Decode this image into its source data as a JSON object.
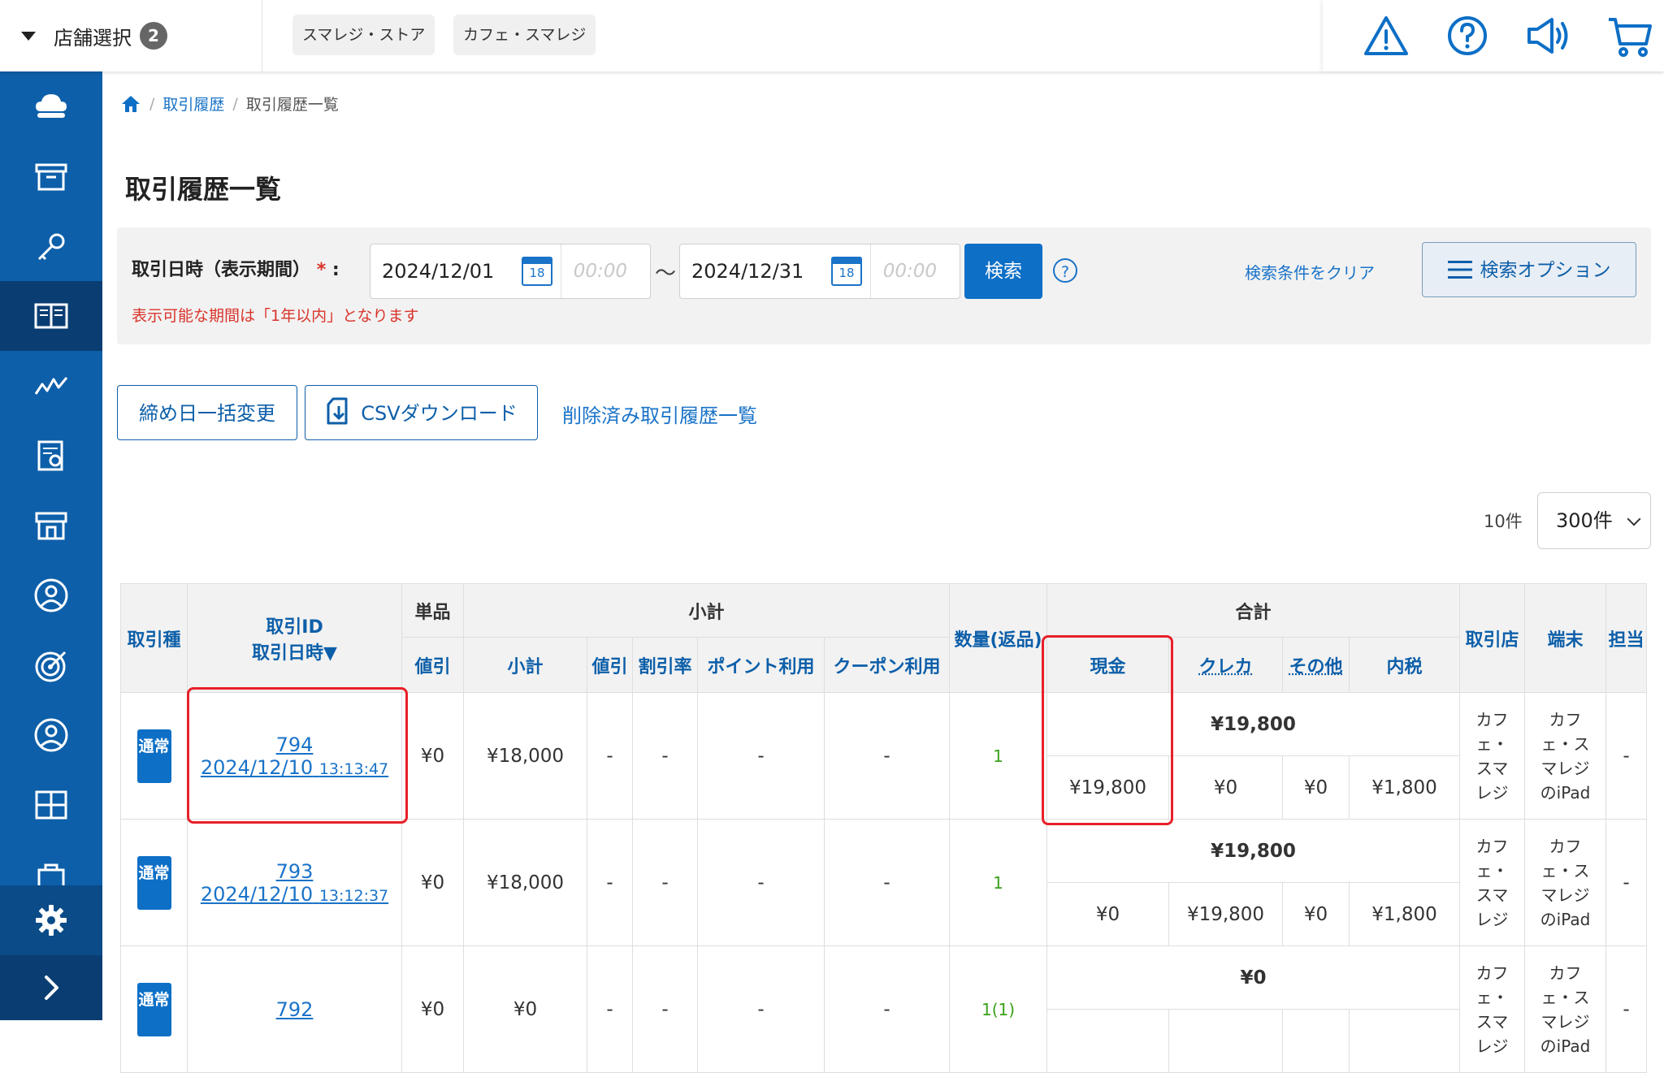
{
  "topbar": {
    "store_select_label": "店舗選択",
    "store_count": "2",
    "stores": [
      "スマレジ・ストア",
      "カフェ・スマレジ"
    ],
    "icons": [
      "alert-icon",
      "help-icon",
      "announcement-icon",
      "cart-icon"
    ]
  },
  "sidebar": {
    "items": [
      "cloud-icon",
      "archive-icon",
      "key-icon",
      "book-icon",
      "chart-icon",
      "report-icon",
      "store-icon",
      "user-icon",
      "target-icon",
      "member-icon",
      "grid-icon",
      "bag-icon"
    ],
    "active_item": "book-icon",
    "bottom": [
      "settings-icon",
      "expand-icon"
    ]
  },
  "breadcrumb": {
    "items": [
      "取引履歴",
      "取引履歴一覧"
    ]
  },
  "page_title": "取引履歴一覧",
  "filter": {
    "label": "取引日時（表示期間）",
    "required_mark": "*",
    "colon": ":",
    "start_date": "2024/12/01",
    "start_time_placeholder": "00:00",
    "end_date": "2024/12/31",
    "end_time_placeholder": "00:00",
    "calendar_day": "18",
    "tilde": "〜",
    "search_label": "検索",
    "help": "?",
    "clear_label": "検索条件をクリア",
    "options_label": "検索オプション",
    "error_text": "表示可能な期間は「1年以内」となります"
  },
  "actions": {
    "bulk_close": "締め日一括変更",
    "csv": "CSVダウンロード",
    "deleted_link": "削除済み取引履歴一覧"
  },
  "paging": {
    "count_label": "10件",
    "per_page": "300件"
  },
  "table": {
    "headers": {
      "kind": "取引種",
      "id_line1": "取引ID",
      "id_line2": "取引日時▼",
      "unit_group": "単品",
      "unit_discount": "値引",
      "subtotal_group": "小計",
      "subtotal": "小計",
      "discount": "値引",
      "discount_rate": "割引率",
      "point": "ポイント利用",
      "coupon": "クーポン利用",
      "qty": "数量(返品)",
      "total_group": "合計",
      "cash": "現金",
      "credit": "クレカ",
      "other": "その他",
      "tax": "内税",
      "store": "取引店",
      "terminal": "端末",
      "staff": "担当"
    },
    "rows": [
      {
        "kind": "通常",
        "id": "794",
        "date": "2024/12/10",
        "time": "13:13:47",
        "unit_discount": "¥0",
        "subtotal": "¥18,000",
        "discount": "-",
        "rate": "-",
        "point": "-",
        "coupon": "-",
        "qty": "1",
        "total": "¥19,800",
        "cash": "¥19,800",
        "credit": "¥0",
        "other": "¥0",
        "tax": "¥1,800",
        "store": "カフェ・スマレジ",
        "terminal": "カフェ・スマレジのiPad",
        "staff": "-"
      },
      {
        "kind": "通常",
        "id": "793",
        "date": "2024/12/10",
        "time": "13:12:37",
        "unit_discount": "¥0",
        "subtotal": "¥18,000",
        "discount": "-",
        "rate": "-",
        "point": "-",
        "coupon": "-",
        "qty": "1",
        "total": "¥19,800",
        "cash": "¥0",
        "credit": "¥19,800",
        "other": "¥0",
        "tax": "¥1,800",
        "store": "カフェ・スマレジ",
        "terminal": "カフェ・スマレジのiPad",
        "staff": "-"
      },
      {
        "kind": "通常",
        "id": "792",
        "unit_discount": "¥0",
        "subtotal": "¥0",
        "discount": "-",
        "rate": "-",
        "point": "-",
        "coupon": "-",
        "qty": "1(1)",
        "total": "¥0",
        "store": "カフェ・スマレジ",
        "terminal": "カフェ・スマレジのiPad",
        "staff": "-"
      }
    ]
  },
  "colors": {
    "primary": "#0d5fa9",
    "sidebar": "#0d5fa9",
    "sidebar_active": "#0a3e72",
    "highlight": "#e8202a",
    "required": "#d9342b",
    "quantity": "#3aa11a"
  }
}
